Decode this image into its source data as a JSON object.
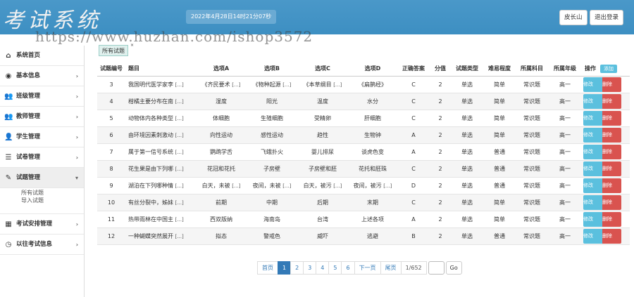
{
  "header": {
    "logo": "考试系统",
    "datetime": "2022年4月28日14时21分07秒",
    "user": "皮长山",
    "logout": "退出登录",
    "watermark": "https://www.huzhan.com/ishop3572"
  },
  "sidebar": {
    "items": [
      {
        "label": "系统首页",
        "icon": "home-icon",
        "glyph": "⌂",
        "arrow": ""
      },
      {
        "label": "基本信息",
        "icon": "info-icon",
        "glyph": "◉",
        "arrow": "›"
      },
      {
        "label": "班级管理",
        "icon": "users-icon",
        "glyph": "👥",
        "arrow": "›"
      },
      {
        "label": "教师管理",
        "icon": "users-icon",
        "glyph": "👥",
        "arrow": "›"
      },
      {
        "label": "学生管理",
        "icon": "user-icon",
        "glyph": "👤",
        "arrow": "›"
      },
      {
        "label": "试卷管理",
        "icon": "list-icon",
        "glyph": "☰",
        "arrow": "›"
      },
      {
        "label": "试题管理",
        "icon": "edit-icon",
        "glyph": "✎",
        "arrow": "▾"
      },
      {
        "label": "考试安排管理",
        "icon": "table-icon",
        "glyph": "▦",
        "arrow": "›"
      },
      {
        "label": "以往考试信息",
        "icon": "clock-icon",
        "glyph": "◷",
        "arrow": "›"
      }
    ],
    "submenu": [
      "所有试题",
      "导入试题"
    ]
  },
  "tab": {
    "label": "所有试题",
    "close": "×"
  },
  "table": {
    "headers": [
      "试题编号",
      "题目",
      "选项A",
      "选项B",
      "选项C",
      "选项D",
      "正确答案",
      "分值",
      "试题类型",
      "难易程度",
      "所属科目",
      "所属年级",
      "操作"
    ],
    "add_label": "添加",
    "edit_label": "修改",
    "delete_label": "删除",
    "ellipsis": "[...]",
    "rows": [
      {
        "id": "3",
        "title": "我国明代医学家李",
        "a": "《齐民要术",
        "a_more": true,
        "b": "《物种起源",
        "b_more": true,
        "c": "《本草纲目",
        "c_more": true,
        "d": "《扁鹊经》",
        "d_more": false,
        "answer": "C",
        "score": "2",
        "type": "单选",
        "level": "简单",
        "subject": "常识题",
        "grade": "高一"
      },
      {
        "id": "4",
        "title": "柑橘主要分布在南",
        "a": "湿度",
        "a_more": false,
        "b": "阳光",
        "b_more": false,
        "c": "温度",
        "c_more": false,
        "d": "水分",
        "d_more": false,
        "answer": "C",
        "score": "2",
        "type": "单选",
        "level": "简单",
        "subject": "常识题",
        "grade": "高一"
      },
      {
        "id": "5",
        "title": "动物体内各种类型",
        "a": "体细胞",
        "a_more": false,
        "b": "生殖细胞",
        "b_more": false,
        "c": "受精卵",
        "c_more": false,
        "d": "肝细胞",
        "d_more": false,
        "answer": "C",
        "score": "2",
        "type": "单选",
        "level": "简单",
        "subject": "常识题",
        "grade": "高一"
      },
      {
        "id": "6",
        "title": "由环境因素刺激动",
        "a": "向性运动",
        "a_more": false,
        "b": "感性运动",
        "b_more": false,
        "c": "趋性",
        "c_more": false,
        "d": "生物钟",
        "d_more": false,
        "answer": "A",
        "score": "2",
        "type": "单选",
        "level": "简单",
        "subject": "常识题",
        "grade": "高一"
      },
      {
        "id": "7",
        "title": "属于第一信号系统",
        "a": "鹦鹉学舌",
        "a_more": false,
        "b": "飞蛾扑火",
        "b_more": false,
        "c": "婴儿排尿",
        "c_more": false,
        "d": "谈虎色变",
        "d_more": false,
        "answer": "A",
        "score": "2",
        "type": "单选",
        "level": "普通",
        "subject": "常识题",
        "grade": "高一"
      },
      {
        "id": "8",
        "title": "花生果是由下列哪",
        "a": "花冠和花托",
        "a_more": false,
        "b": "子房壁",
        "b_more": false,
        "c": "子房壁和胚",
        "c_more": false,
        "d": "花托和胚珠",
        "d_more": false,
        "answer": "C",
        "score": "2",
        "type": "单选",
        "level": "普通",
        "subject": "常识题",
        "grade": "高一"
      },
      {
        "id": "9",
        "title": "湖泊在下列哪种情",
        "a": "白天，未被",
        "a_more": true,
        "b": "夜间，未被",
        "b_more": true,
        "c": "白天，被污",
        "c_more": true,
        "d": "夜间，被污",
        "d_more": true,
        "answer": "D",
        "score": "2",
        "type": "单选",
        "level": "普通",
        "subject": "常识题",
        "grade": "高一"
      },
      {
        "id": "10",
        "title": "有丝分裂中，姊妹",
        "a": "前期",
        "a_more": false,
        "b": "中期",
        "b_more": false,
        "c": "后期",
        "c_more": false,
        "d": "末期",
        "d_more": false,
        "answer": "C",
        "score": "2",
        "type": "单选",
        "level": "简单",
        "subject": "常识题",
        "grade": "高一"
      },
      {
        "id": "11",
        "title": "热带雨林在中国主",
        "a": "西双版纳",
        "a_more": false,
        "b": "海南岛",
        "b_more": false,
        "c": "台湾",
        "c_more": false,
        "d": "上述各项",
        "d_more": false,
        "answer": "A",
        "score": "2",
        "type": "单选",
        "level": "简单",
        "subject": "常识题",
        "grade": "高一"
      },
      {
        "id": "12",
        "title": "一种蝴蝶突然展开",
        "a": "拟态",
        "a_more": false,
        "b": "警戒色",
        "b_more": false,
        "c": "威吓",
        "c_more": false,
        "d": "逃避",
        "d_more": false,
        "answer": "B",
        "score": "2",
        "type": "单选",
        "level": "普通",
        "subject": "常识题",
        "grade": "高一"
      }
    ]
  },
  "pagination": {
    "first": "首页",
    "pages": [
      "1",
      "2",
      "3",
      "4",
      "5",
      "6"
    ],
    "current": "1",
    "next": "下一页",
    "last": "尾页",
    "info": "1/652",
    "go": "Go"
  },
  "colors": {
    "header_bg": "#3d8fc2",
    "edit_button": "#5bc0de",
    "delete_button": "#d9534f",
    "active_page": "#337ab7"
  }
}
